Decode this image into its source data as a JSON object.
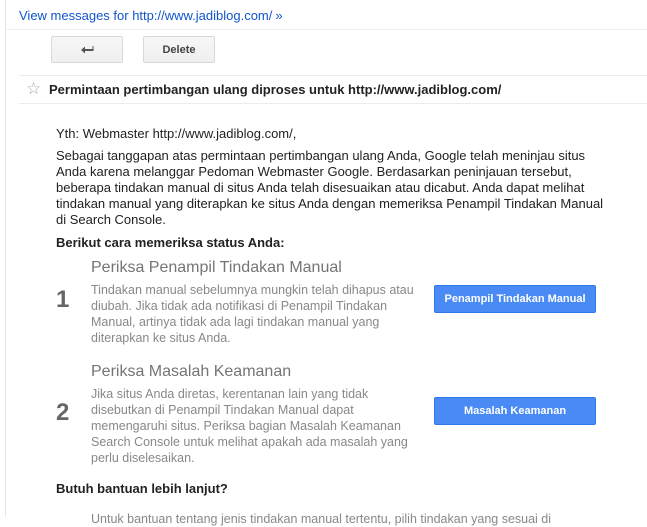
{
  "top_link": {
    "text": "View messages for http://www.jadiblog.com/",
    "arrow": "»"
  },
  "toolbar": {
    "back_icon": "reply-arrow-icon",
    "delete_label": "Delete"
  },
  "message": {
    "star_icon": "star-outline-icon",
    "subject": "Permintaan pertimbangan ulang diproses untuk http://www.jadiblog.com/",
    "greeting": "Yth: Webmaster http://www.jadiblog.com/,",
    "intro": "Sebagai tanggapan atas permintaan pertimbangan ulang Anda, Google telah meninjau situs Anda karena melanggar Pedoman Webmaster Google. Berdasarkan peninjauan tersebut, beberapa tindakan manual di situs Anda telah disesuaikan atau dicabut. Anda dapat melihat tindakan manual yang diterapkan ke situs Anda dengan memeriksa Penampil Tindakan Manual di Search Console.",
    "status_heading": "Berikut cara memeriksa status Anda:",
    "steps": [
      {
        "number": "1",
        "title": "Periksa Penampil Tindakan Manual",
        "body": "Tindakan manual sebelumnya mungkin telah dihapus atau diubah. Jika tidak ada notifikasi di Penampil Tindakan Manual, artinya tidak ada lagi tindakan manual yang diterapkan ke situs Anda.",
        "button": "Penampil Tindakan Manual"
      },
      {
        "number": "2",
        "title": "Periksa Masalah Keamanan",
        "body": "Jika situs Anda diretas, kerentanan lain yang tidak disebutkan di Penampil Tindakan Manual dapat memengaruhi situs. Periksa bagian Masalah Keamanan Search Console untuk melihat apakah ada masalah yang perlu diselesaikan.",
        "button": "Masalah Keamanan"
      }
    ],
    "help_heading": "Butuh bantuan lebih lanjut?",
    "help_body": "Untuk bantuan tentang jenis tindakan manual tertentu, pilih tindakan yang sesuai di"
  },
  "colors": {
    "link": "#1155cc",
    "primary_button": "#4a8af4"
  }
}
